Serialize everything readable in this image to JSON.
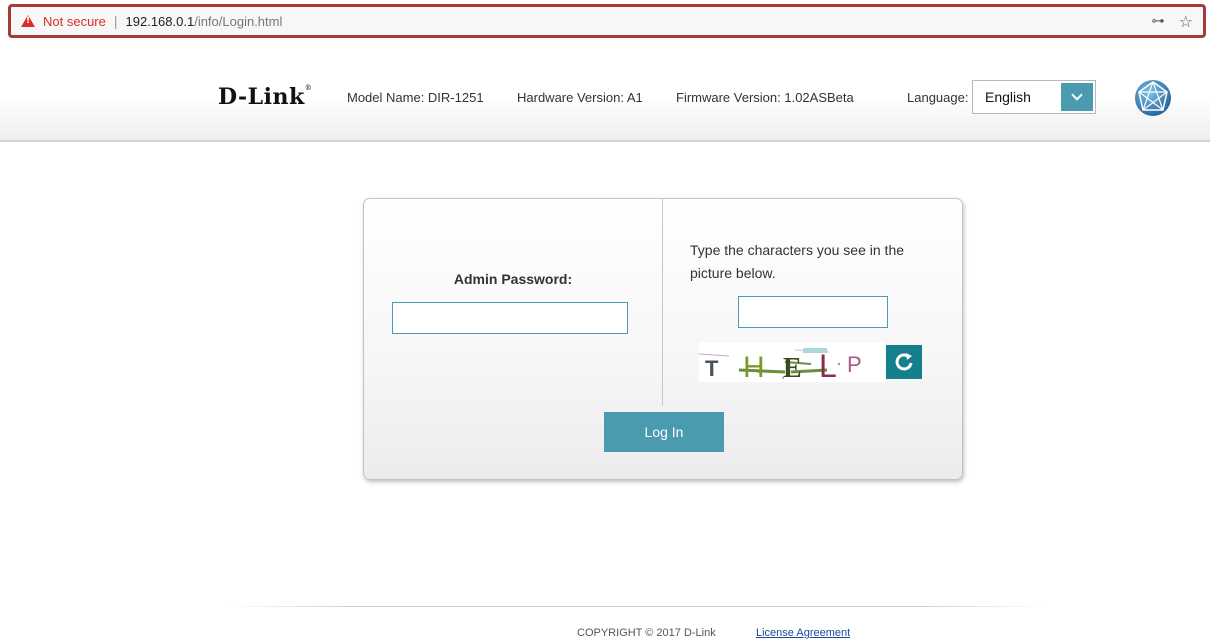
{
  "browser": {
    "security_label": "Not secure",
    "separator": "|",
    "url_host": "192.168.0.1",
    "url_path": "/info/Login.html",
    "warning_color": "#d93025"
  },
  "header": {
    "logo_text": "D-Link",
    "logo_mark": "®",
    "model_name": "Model Name: DIR-1251",
    "hardware_version": "Hardware Version: A1",
    "firmware_version": "Firmware Version: 1.02ASBeta",
    "language_label": "Language:",
    "language_selected": "English",
    "accent_color": "#4b9bb0"
  },
  "login": {
    "password_label": "Admin Password:",
    "password_value": "",
    "captcha_instruction": "Type the characters you see in the picture below.",
    "captcha_value": "",
    "captcha_image_text": "THELP",
    "login_button": "Log In"
  },
  "footer": {
    "copyright": "COPYRIGHT © 2017 D-Link",
    "license_link": "License Agreement"
  }
}
